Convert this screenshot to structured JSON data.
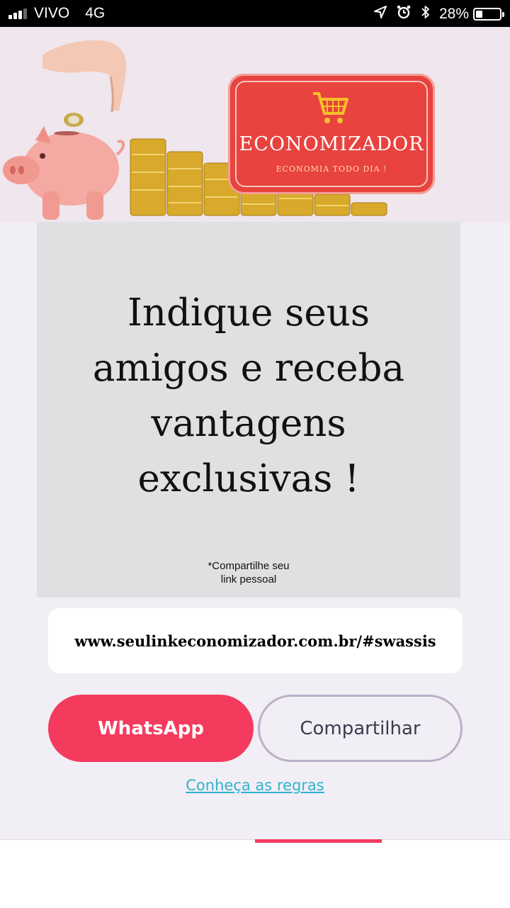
{
  "status_bar": {
    "carrier": "VIVO",
    "network": "4G",
    "battery_percent": "28%"
  },
  "banner": {
    "brand": "ECONOMIZADOR",
    "tagline": "ECONOMIA TODO DIA !"
  },
  "promo": {
    "headline": "Indique seus amigos e receba vantagens exclusivas !",
    "note_line1": "*Compartilhe seu",
    "note_line2": "link pessoal"
  },
  "link": {
    "url": "www.seulinkeconomizador.com.br/#swassis"
  },
  "actions": {
    "whatsapp_label": "WhatsApp",
    "share_label": "Compartilhar",
    "rules_label": "Conheça as regras"
  },
  "colors": {
    "accent": "#f43b5e",
    "link": "#2fb3c8",
    "logo_red": "#e8433f"
  }
}
